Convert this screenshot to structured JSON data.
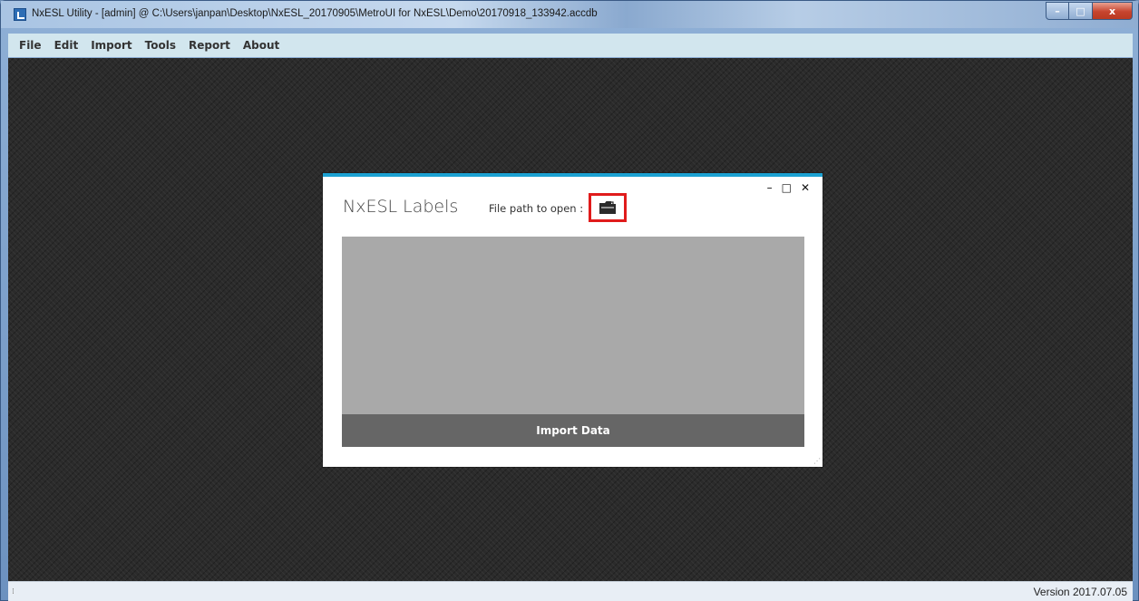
{
  "window": {
    "title": "NxESL Utility - [admin] @ C:\\Users\\janpan\\Desktop\\NxESL_20170905\\MetroUI for NxESL\\Demo\\20170918_133942.accdb",
    "min_label": "–",
    "max_label": "□",
    "close_label": "x"
  },
  "menu": {
    "items": [
      "File",
      "Edit",
      "Import",
      "Tools",
      "Report",
      "About"
    ]
  },
  "dialog": {
    "title": "NxESL Labels",
    "path_label": "File path to open :",
    "minimize_label": "–",
    "maximize_label": "□",
    "close_label": "✕",
    "import_button": "Import Data",
    "folder_icon": "folder-open-icon",
    "accent_color": "#1ba1d2",
    "highlight_color": "#e01b1b"
  },
  "status": {
    "version": "Version 2017.07.05"
  }
}
